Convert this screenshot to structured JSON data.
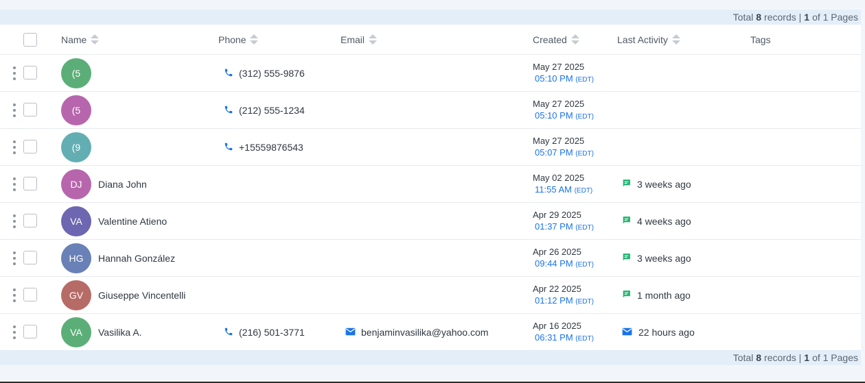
{
  "pagination": {
    "total_label": "Total",
    "total_count": "8",
    "records_label": "records |",
    "current_page": "1",
    "of_label": "of 1 Pages"
  },
  "columns": {
    "name": "Name",
    "phone": "Phone",
    "email": "Email",
    "created": "Created",
    "last_activity": "Last Activity",
    "tags": "Tags"
  },
  "rows": [
    {
      "initials": "(5",
      "avatar_color": "#5cae78",
      "name": "",
      "phone": "(312) 555-9876",
      "email": "",
      "created_date": "May 27 2025",
      "created_time": "05:10 PM",
      "tz": "(EDT)",
      "activity_icon": "",
      "activity": ""
    },
    {
      "initials": "(5",
      "avatar_color": "#b766ad",
      "name": "",
      "phone": "(212) 555-1234",
      "email": "",
      "created_date": "May 27 2025",
      "created_time": "05:10 PM",
      "tz": "(EDT)",
      "activity_icon": "",
      "activity": ""
    },
    {
      "initials": "(9",
      "avatar_color": "#63aeb3",
      "name": "",
      "phone": "+15559876543",
      "email": "",
      "created_date": "May 27 2025",
      "created_time": "05:07 PM",
      "tz": "(EDT)",
      "activity_icon": "",
      "activity": ""
    },
    {
      "initials": "DJ",
      "avatar_color": "#b766ad",
      "name": "Diana John",
      "phone": "",
      "email": "",
      "created_date": "May 02 2025",
      "created_time": "11:55 AM",
      "tz": "(EDT)",
      "activity_icon": "chat-icon",
      "activity": "3 weeks ago"
    },
    {
      "initials": "VA",
      "avatar_color": "#6d66b0",
      "name": "Valentine Atieno",
      "phone": "",
      "email": "",
      "created_date": "Apr 29 2025",
      "created_time": "01:37 PM",
      "tz": "(EDT)",
      "activity_icon": "chat-icon",
      "activity": "4 weeks ago"
    },
    {
      "initials": "HG",
      "avatar_color": "#6981b6",
      "name": "Hannah González",
      "phone": "",
      "email": "",
      "created_date": "Apr 26 2025",
      "created_time": "09:44 PM",
      "tz": "(EDT)",
      "activity_icon": "chat-icon",
      "activity": "3 weeks ago"
    },
    {
      "initials": "GV",
      "avatar_color": "#b76b66",
      "name": "Giuseppe Vincentelli",
      "phone": "",
      "email": "",
      "created_date": "Apr 22 2025",
      "created_time": "01:12 PM",
      "tz": "(EDT)",
      "activity_icon": "chat-icon",
      "activity": "1 month ago"
    },
    {
      "initials": "VA",
      "avatar_color": "#5cae78",
      "name": "Vasilika A.",
      "phone": "(216) 501-3771",
      "email": "benjaminvasilika@yahoo.com",
      "created_date": "Apr 16 2025",
      "created_time": "06:31 PM",
      "tz": "(EDT)",
      "activity_icon": "email-icon",
      "activity": "22 hours ago"
    }
  ],
  "colors": {
    "accent": "#1a73e8",
    "chat": "#22b573",
    "pager_bg": "#e4eef9"
  }
}
